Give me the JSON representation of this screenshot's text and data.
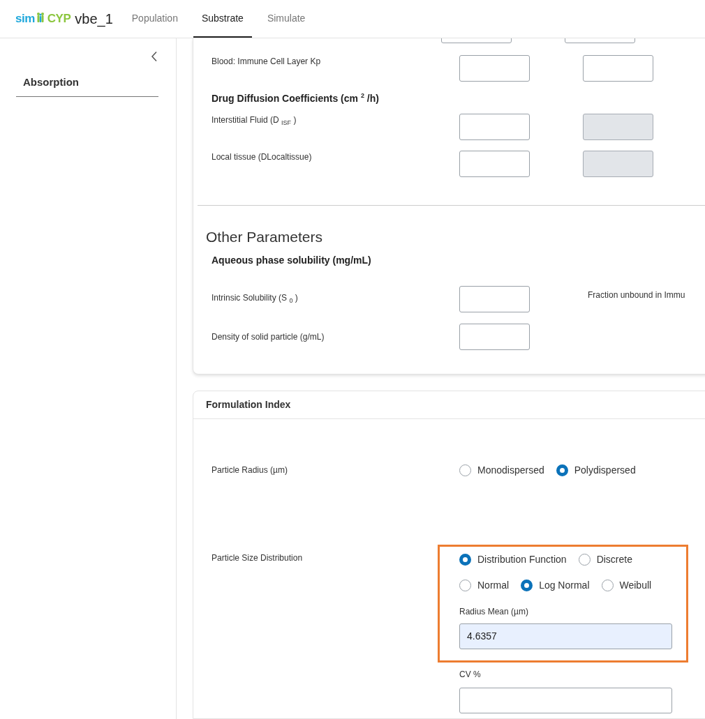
{
  "header": {
    "logo": [
      "sim",
      "CYP"
    ],
    "project": "vbe_1",
    "tabs": [
      {
        "label": "Population",
        "selected": false
      },
      {
        "label": "Substrate",
        "selected": true
      },
      {
        "label": "Simulate",
        "selected": false
      }
    ]
  },
  "sidebar": {
    "items": [
      {
        "label": "Absorption"
      }
    ]
  },
  "tissue_card": {
    "partial_inputs": [
      {
        "disabled": false
      },
      {
        "disabled": false
      }
    ],
    "rows": [
      {
        "kind": "field",
        "label": "Blood: Immune Cell Layer Kp",
        "inputs": [
          {
            "disabled": false
          },
          {
            "disabled": false
          }
        ]
      },
      {
        "kind": "heading",
        "label": "Drug Diffusion Coefficients (cm $^{2}$ /h)"
      },
      {
        "kind": "field",
        "label": "Interstitial Fluid (D $_{ISF}$ )",
        "inputs": [
          {
            "disabled": false
          },
          {
            "disabled": true
          }
        ]
      },
      {
        "kind": "field",
        "label": "Local tissue (DLocaltissue)",
        "inputs": [
          {
            "disabled": false
          },
          {
            "disabled": true
          }
        ]
      }
    ]
  },
  "other_parameters": {
    "title": "Other Parameters",
    "subtitle": "Aqueous phase solubility (mg/mL)",
    "rows": [
      {
        "label": "Intrinsic Solubility (S $_{0}$ )",
        "inputs": [
          {
            "disabled": false
          }
        ]
      },
      {
        "label": "Density of solid particle (g/mL)",
        "inputs": [
          {
            "disabled": false
          }
        ]
      }
    ],
    "side_label": "Fraction unbound in Immu"
  },
  "formulation": {
    "title": "Formulation Index",
    "particle_radius": {
      "label": "Particle Radius (µm)",
      "options": [
        {
          "label": "Monodispersed",
          "selected": false
        },
        {
          "label": "Polydispersed",
          "selected": true
        }
      ]
    },
    "size_distribution": {
      "label": "Particle Size Distribution",
      "method_options": [
        {
          "label": "Distribution Function",
          "selected": true
        },
        {
          "label": "Discrete",
          "selected": false
        }
      ],
      "function_options": [
        {
          "label": "Normal",
          "selected": false
        },
        {
          "label": "Log Normal",
          "selected": true
        },
        {
          "label": "Weibull",
          "selected": false
        }
      ],
      "radius_mean": {
        "label": "Radius Mean (µm)",
        "value": "4.6357"
      },
      "cv": {
        "label": "CV %"
      }
    }
  }
}
